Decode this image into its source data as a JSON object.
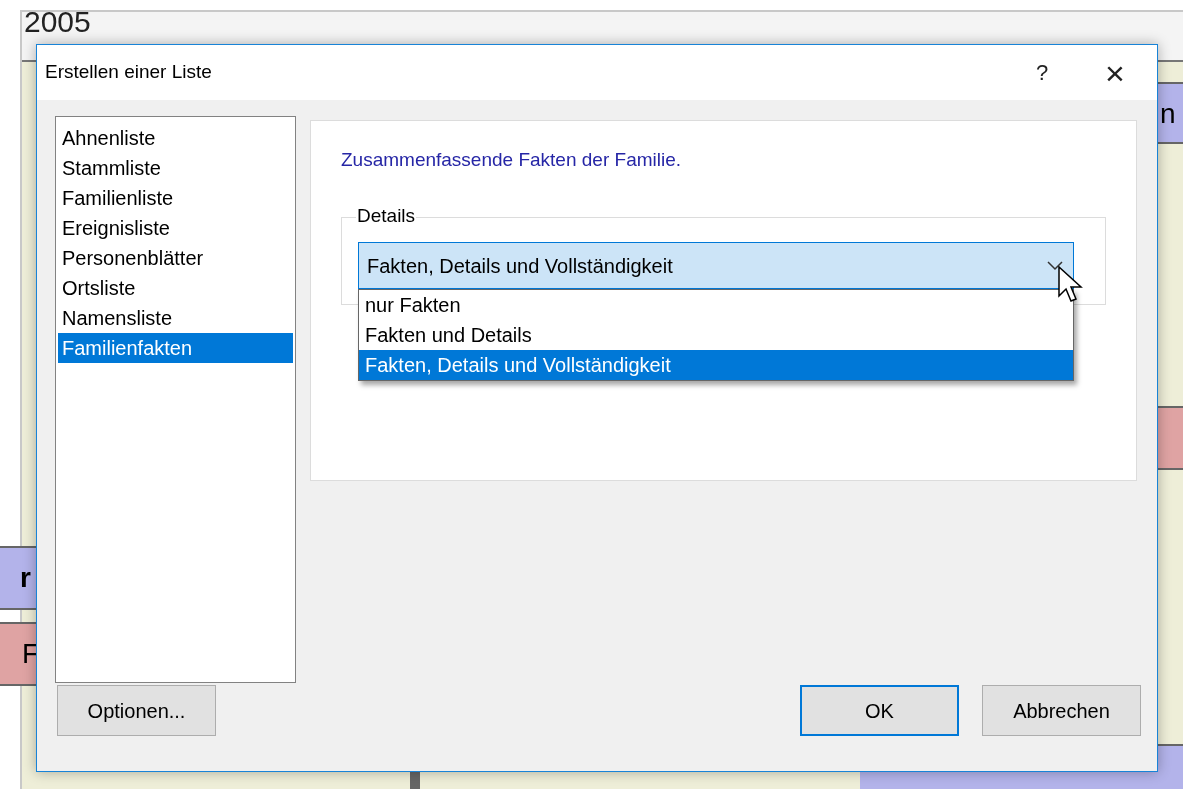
{
  "background": {
    "year": "2005",
    "nodes": [
      {
        "text": "n",
        "color": "#b3b3ea"
      },
      {
        "color": "#dfa3a3"
      },
      {
        "text": "r",
        "color": "#b3b3ea"
      },
      {
        "text": "F",
        "color": "#dfa3a3"
      },
      {
        "color": "#b3b3ea"
      }
    ]
  },
  "dialog": {
    "title": "Erstellen einer Liste",
    "help": "?",
    "close": "×",
    "lists": [
      {
        "label": "Ahnenliste",
        "selected": false
      },
      {
        "label": "Stammliste",
        "selected": false
      },
      {
        "label": "Familienliste",
        "selected": false
      },
      {
        "label": "Ereignisliste",
        "selected": false
      },
      {
        "label": "Personenblätter",
        "selected": false
      },
      {
        "label": "Ortsliste",
        "selected": false
      },
      {
        "label": "Namensliste",
        "selected": false
      },
      {
        "label": "Familienfakten",
        "selected": true
      }
    ],
    "description": "Zusammenfassende Fakten der Familie.",
    "group": {
      "label": "Details",
      "value": "Fakten, Details und Vollständigkeit",
      "expanded": true,
      "options": [
        {
          "label": "nur Fakten",
          "selected": false
        },
        {
          "label": "Fakten und Details",
          "selected": false
        },
        {
          "label": "Fakten, Details und Vollständigkeit",
          "selected": true
        }
      ]
    },
    "buttons": [
      {
        "label": "Optionen...",
        "default": false
      },
      {
        "label": "OK",
        "default": true
      },
      {
        "label": "Abbrechen",
        "default": false
      }
    ]
  }
}
